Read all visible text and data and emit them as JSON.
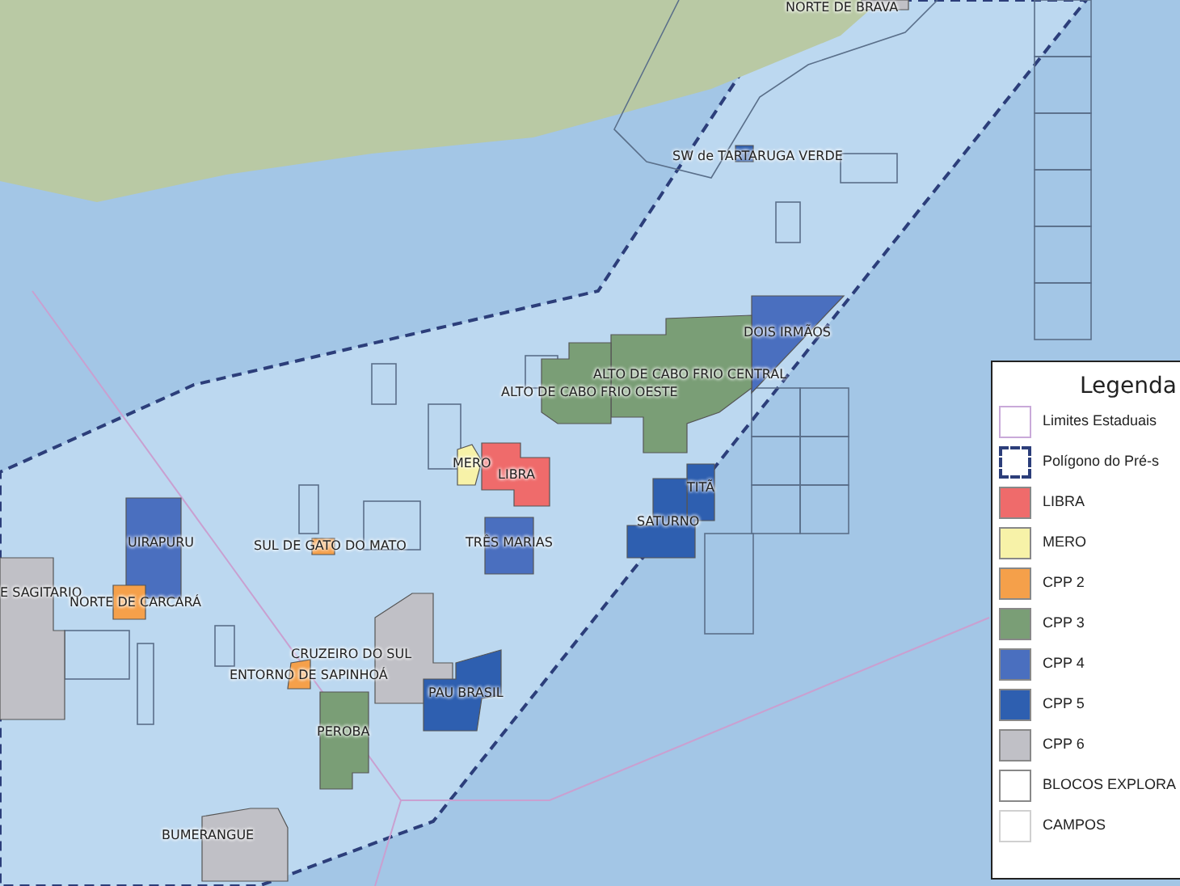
{
  "map": {
    "fields": [
      {
        "label": "NORTE DE BRAVA",
        "color": "#c0c0c6"
      },
      {
        "label": "SW de TARTARUGA VERDE",
        "color": "#2e5fb0"
      },
      {
        "label": "DOIS IRMÃOS",
        "color": "#4a6fbf"
      },
      {
        "label": "ALTO DE CABO FRIO CENTRAL",
        "color": "#7a9e76"
      },
      {
        "label": "ALTO DE CABO FRIO OESTE",
        "color": "#7a9e76"
      },
      {
        "label": "MERO",
        "color": "#f7f2a8"
      },
      {
        "label": "LIBRA",
        "color": "#ef6b6b"
      },
      {
        "label": "TITÃ",
        "color": "#2e5fb0"
      },
      {
        "label": "SATURNO",
        "color": "#2e5fb0"
      },
      {
        "label": "UIRAPURU",
        "color": "#4a6fbf"
      },
      {
        "label": "SUL DE GATO DO MATO",
        "color": "#f5a04a"
      },
      {
        "label": "TRÊS MARIAS",
        "color": "#4a6fbf"
      },
      {
        "label": "E SAGITARIO",
        "color": "#c0c0c6"
      },
      {
        "label": "NORTE DE CARCARÁ",
        "color": "#f5a04a"
      },
      {
        "label": "CRUZEIRO DO SUL",
        "color": "#c0c0c6"
      },
      {
        "label": "ENTORNO DE SAPINHOÁ",
        "color": "#f5a04a"
      },
      {
        "label": "PAU BRASIL",
        "color": "#2e5fb0"
      },
      {
        "label": "PEROBA",
        "color": "#7a9e76"
      },
      {
        "label": "BUMERANGUE",
        "color": "#c0c0c6"
      }
    ]
  },
  "legend": {
    "title": "Legenda",
    "items": [
      {
        "label": "Limites Estaduais",
        "kind": "outline",
        "color": "#c9a9d9"
      },
      {
        "label": "Polígono do Pré-s",
        "kind": "dashed",
        "color": "#2c3e7a"
      },
      {
        "label": "LIBRA",
        "kind": "fill",
        "color": "#ef6b6b"
      },
      {
        "label": "MERO",
        "kind": "fill",
        "color": "#f7f2a8"
      },
      {
        "label": "CPP 2",
        "kind": "fill",
        "color": "#f5a04a"
      },
      {
        "label": "CPP 3",
        "kind": "fill",
        "color": "#7a9e76"
      },
      {
        "label": "CPP 4",
        "kind": "fill",
        "color": "#4a6fbf"
      },
      {
        "label": "CPP 5",
        "kind": "fill",
        "color": "#2e5fb0"
      },
      {
        "label": "CPP 6",
        "kind": "fill",
        "color": "#c0c0c6"
      },
      {
        "label": "BLOCOS EXPLORA",
        "kind": "outline",
        "color": "#888888"
      },
      {
        "label": "CAMPOS",
        "kind": "outline",
        "color": "#d0d0d0"
      }
    ]
  }
}
